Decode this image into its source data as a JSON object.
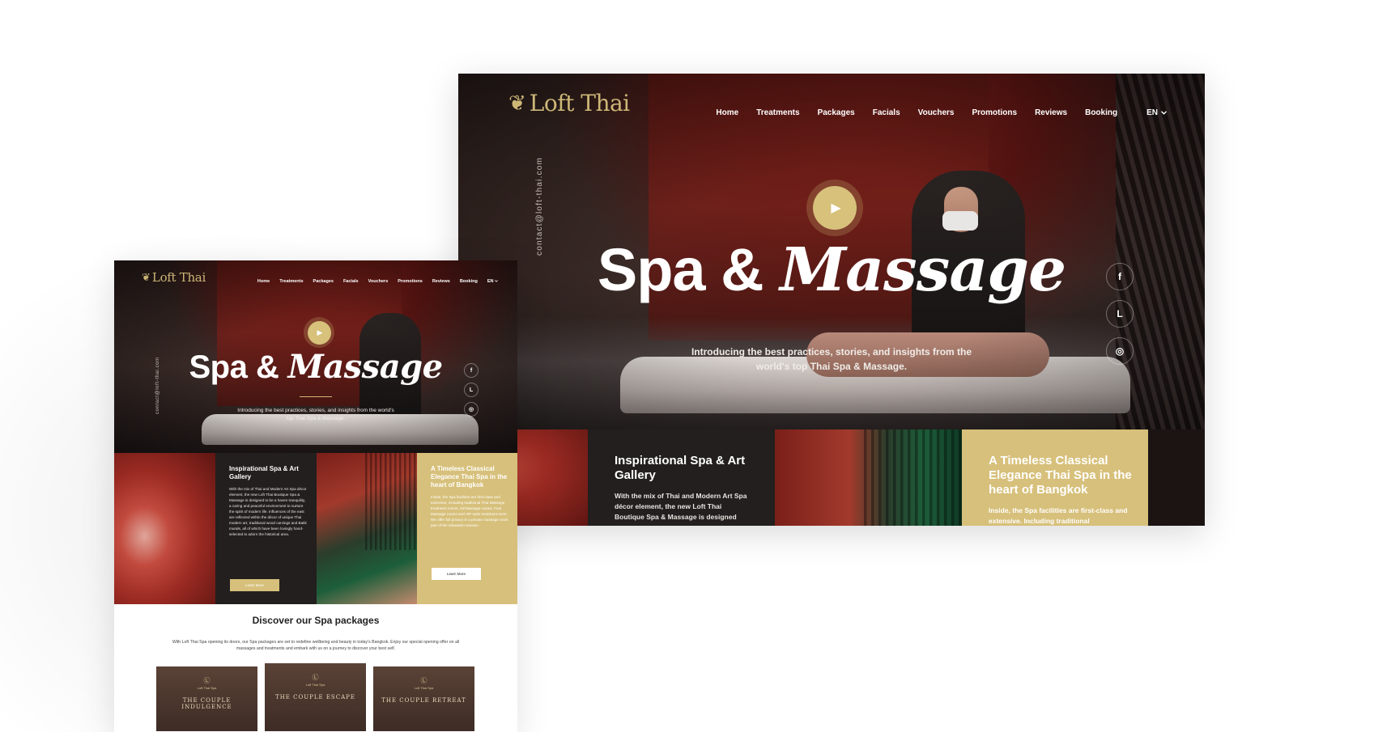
{
  "brand": {
    "logo_leaf": "❦",
    "logo_name": "Loft Thai",
    "gold": "#d7c07b",
    "dark": "#221f1e"
  },
  "nav": {
    "items": [
      "Home",
      "Treatments",
      "Packages",
      "Facials",
      "Vouchers",
      "Promotions",
      "Reviews",
      "Booking"
    ],
    "lang": "EN",
    "lang_icon": "chevron-down-icon"
  },
  "hero": {
    "email": "contact@loft-thai.com",
    "title_plain": "Spa &",
    "title_script": "Massage",
    "intro": "Introducing the best practices, stories, and insights from the world's top Thai Spa & Massage.",
    "play_icon": "▶",
    "social": {
      "facebook": "f",
      "line": "L",
      "instagram": "◎"
    }
  },
  "features": {
    "gallery": {
      "title": "Inspirational Spa & Art Gallery",
      "text_short": "With the mix of Thai and Modern Art Spa décor element, the new Loft Thai Boutique Spa & Massage is designed",
      "text_long": "With the mix of Thai and Modern Art Spa décor element, the new Loft Thai Boutique Spa & Massage is designed to be a haven tranquility, a caring and peaceful environment to nurture the spirit of modern life. Influences of the east are reflected within the décor of unique Thai modern art, traditional wood carvings and Batik murals, all of which have been lovingly hand-selected to adorn the historical area.",
      "button": "Learn More"
    },
    "classical": {
      "title": "A Timeless Classical Elegance Thai Spa in the heart of Bangkok",
      "text_short": "Inside, the Spa facilities are first-class and extensive. Including traditional",
      "text_long": "Inside, the Spa facilities are first-class and extensive, including traditional Thai Massage treatment rooms, Oil Massage rooms, Foot Massage rooms and VIP suite treatment room. We offer full privacy in a private massage room part of the relaxation session.",
      "button": "Learn More"
    }
  },
  "packages": {
    "title": "Discover our Spa packages",
    "description": "With Loft Thai Spa opening its doors, our Spa packages are set to redefine wellbeing and beauty in today's Bangkok. Enjoy our special opening offer on all massages and treatments and embark with us on a journey to discover your best self.",
    "cards": [
      {
        "badge": "Ⓛ",
        "brand": "Loft Thai Spa",
        "name": "THE COUPLE INDULGENCE"
      },
      {
        "badge": "Ⓛ",
        "brand": "Loft Thai Spa",
        "name": "THE COUPLE ESCAPE"
      },
      {
        "badge": "Ⓛ",
        "brand": "Loft Thai Spa",
        "name": "THE COUPLE RETREAT"
      }
    ]
  }
}
